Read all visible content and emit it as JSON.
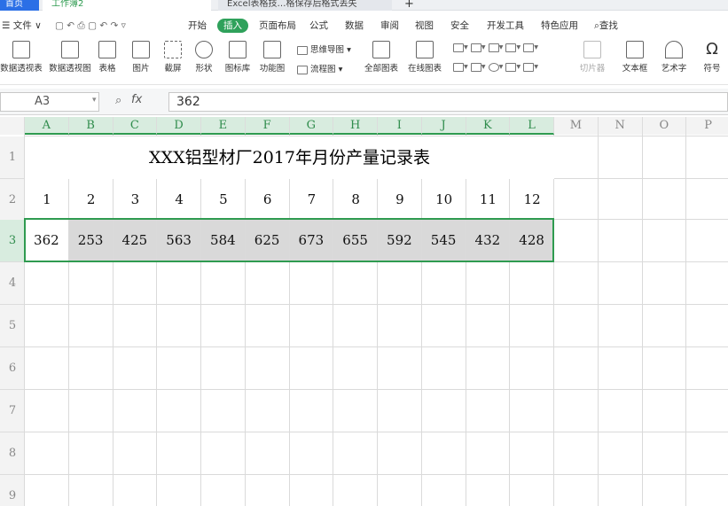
{
  "tabs": {
    "home": "首页",
    "workbook": "工作簿2",
    "document": "Excel表格技…格保存后格式丢失"
  },
  "menu": [
    "文件",
    "开始",
    "插入",
    "页面布局",
    "公式",
    "数据",
    "审阅",
    "视图",
    "安全",
    "开发工具",
    "特色应用",
    "查找"
  ],
  "ribbon": {
    "large": [
      "数据透视表",
      "数据透视图",
      "表格",
      "图片",
      "截屏",
      "形状",
      "图标库",
      "功能图",
      "全部图表",
      "在线图表",
      "切片器",
      "文本框",
      "艺术字",
      "符号"
    ],
    "small": [
      "思维导图",
      "流程图"
    ]
  },
  "formula_bar": {
    "name_box": "A3",
    "fx": "fx",
    "value": "362"
  },
  "sheet": {
    "columns": [
      "A",
      "B",
      "C",
      "D",
      "E",
      "F",
      "G",
      "H",
      "I",
      "J",
      "K",
      "L",
      "M",
      "N",
      "O",
      "P"
    ],
    "rows": [
      "1",
      "2",
      "3",
      "4",
      "5",
      "6",
      "7",
      "8",
      "9"
    ],
    "title": "XXX铝型材厂2017年月份产量记录表",
    "months": [
      "1",
      "2",
      "3",
      "4",
      "5",
      "6",
      "7",
      "8",
      "9",
      "10",
      "11",
      "12"
    ],
    "values": [
      "362",
      "253",
      "425",
      "563",
      "584",
      "625",
      "673",
      "655",
      "592",
      "545",
      "432",
      "428"
    ]
  },
  "colors": {
    "accent": "#2f9b50",
    "home_tab": "#2b6fe6",
    "selected_fill": "#d9d9d9"
  }
}
